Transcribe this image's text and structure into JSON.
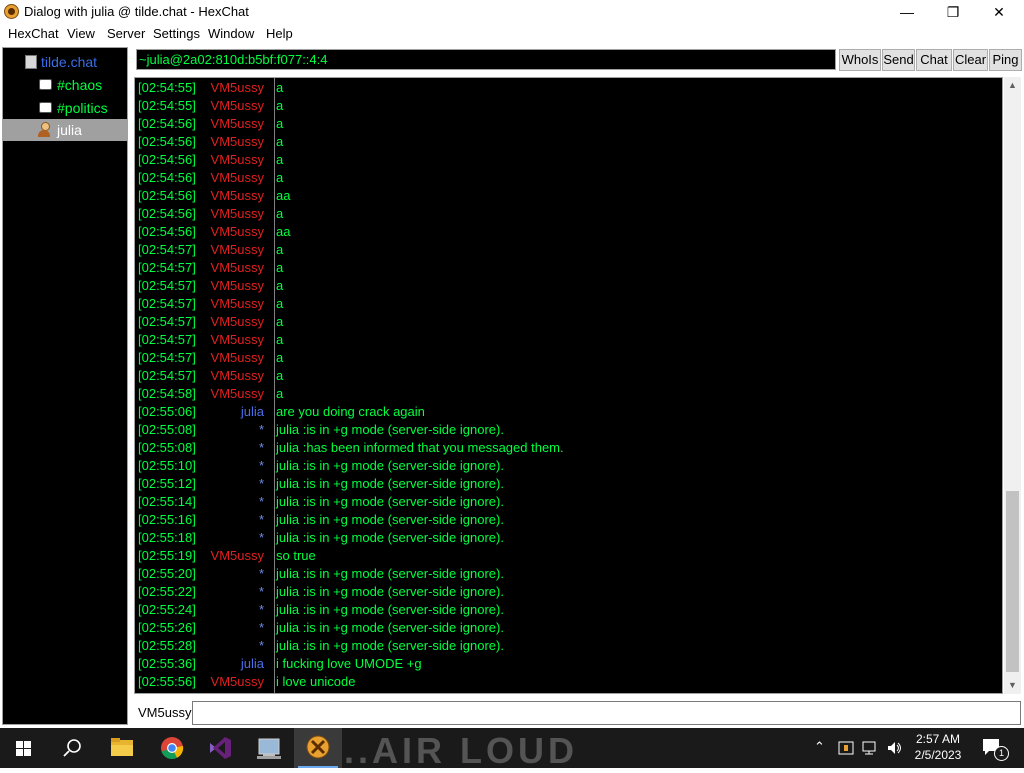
{
  "window": {
    "title": "Dialog with julia @ tilde.chat - HexChat",
    "controls": {
      "minimize": "—",
      "maximize": "❐",
      "close": "✕"
    }
  },
  "menu": {
    "items": [
      "HexChat",
      "View",
      "Server",
      "Settings",
      "Window",
      "Help"
    ]
  },
  "tree": {
    "items": [
      {
        "label": "tilde.chat",
        "kind": "server",
        "color": "#3a6ee8"
      },
      {
        "label": "#chaos",
        "kind": "channel",
        "color": "#00ff40"
      },
      {
        "label": "#politics",
        "kind": "channel",
        "color": "#00ff40"
      },
      {
        "label": "julia",
        "kind": "dialog",
        "color": "#ffffff",
        "selected": true
      }
    ]
  },
  "header": {
    "topic": "~julia@2a02:810d:b5bf:f077::4:4",
    "buttons": [
      "WhoIs",
      "Send",
      "Chat",
      "Clear",
      "Ping"
    ]
  },
  "colors": {
    "timestamp": "#00ff40",
    "nick_vm5ussy": "#e02020",
    "nick_julia": "#4a6ee8",
    "message": "#00ff40",
    "background": "#000000"
  },
  "chat": {
    "lines": [
      {
        "time": "[02:54:55]",
        "nick": "VM5ussy",
        "text": "a"
      },
      {
        "time": "[02:54:55]",
        "nick": "VM5ussy",
        "text": "a"
      },
      {
        "time": "[02:54:56]",
        "nick": "VM5ussy",
        "text": "a"
      },
      {
        "time": "[02:54:56]",
        "nick": "VM5ussy",
        "text": "a"
      },
      {
        "time": "[02:54:56]",
        "nick": "VM5ussy",
        "text": "a"
      },
      {
        "time": "[02:54:56]",
        "nick": "VM5ussy",
        "text": "a"
      },
      {
        "time": "[02:54:56]",
        "nick": "VM5ussy",
        "text": "aa"
      },
      {
        "time": "[02:54:56]",
        "nick": "VM5ussy",
        "text": "a"
      },
      {
        "time": "[02:54:56]",
        "nick": "VM5ussy",
        "text": "aa"
      },
      {
        "time": "[02:54:57]",
        "nick": "VM5ussy",
        "text": "a"
      },
      {
        "time": "[02:54:57]",
        "nick": "VM5ussy",
        "text": "a"
      },
      {
        "time": "[02:54:57]",
        "nick": "VM5ussy",
        "text": "a"
      },
      {
        "time": "[02:54:57]",
        "nick": "VM5ussy",
        "text": "a"
      },
      {
        "time": "[02:54:57]",
        "nick": "VM5ussy",
        "text": "a"
      },
      {
        "time": "[02:54:57]",
        "nick": "VM5ussy",
        "text": "a"
      },
      {
        "time": "[02:54:57]",
        "nick": "VM5ussy",
        "text": "a"
      },
      {
        "time": "[02:54:57]",
        "nick": "VM5ussy",
        "text": "a"
      },
      {
        "time": "[02:54:58]",
        "nick": "VM5ussy",
        "text": "a"
      },
      {
        "time": "[02:55:06]",
        "nick": "julia",
        "text": "are you doing crack again"
      },
      {
        "time": "[02:55:08]",
        "nick": "*",
        "text": "julia :is in +g mode (server-side ignore)."
      },
      {
        "time": "[02:55:08]",
        "nick": "*",
        "text": "julia :has been informed that you messaged them."
      },
      {
        "time": "[02:55:10]",
        "nick": "*",
        "text": "julia :is in +g mode (server-side ignore)."
      },
      {
        "time": "[02:55:12]",
        "nick": "*",
        "text": "julia :is in +g mode (server-side ignore)."
      },
      {
        "time": "[02:55:14]",
        "nick": "*",
        "text": "julia :is in +g mode (server-side ignore)."
      },
      {
        "time": "[02:55:16]",
        "nick": "*",
        "text": "julia :is in +g mode (server-side ignore)."
      },
      {
        "time": "[02:55:18]",
        "nick": "*",
        "text": "julia :is in +g mode (server-side ignore)."
      },
      {
        "time": "[02:55:19]",
        "nick": "VM5ussy",
        "text": "so true"
      },
      {
        "time": "[02:55:20]",
        "nick": "*",
        "text": "julia :is in +g mode (server-side ignore)."
      },
      {
        "time": "[02:55:22]",
        "nick": "*",
        "text": "julia :is in +g mode (server-side ignore)."
      },
      {
        "time": "[02:55:24]",
        "nick": "*",
        "text": "julia :is in +g mode (server-side ignore)."
      },
      {
        "time": "[02:55:26]",
        "nick": "*",
        "text": "julia :is in +g mode (server-side ignore)."
      },
      {
        "time": "[02:55:28]",
        "nick": "*",
        "text": "julia :is in +g mode (server-side ignore)."
      },
      {
        "time": "[02:55:36]",
        "nick": "julia",
        "text": "i fucking love UMODE +g"
      },
      {
        "time": "[02:55:56]",
        "nick": "VM5ussy",
        "text": "i love unicode"
      }
    ]
  },
  "input": {
    "nick": "VM5ussy",
    "value": ""
  },
  "taskbar": {
    "apps": [
      "start-icon",
      "search-icon",
      "file-explorer-icon",
      "chrome-icon",
      "visual-studio-icon",
      "control-panel-icon",
      "hexchat-icon"
    ],
    "clock_time": "2:57 AM",
    "clock_date": "2/5/2023",
    "notification_count": "1",
    "background_text": "...AIR LOUD"
  }
}
